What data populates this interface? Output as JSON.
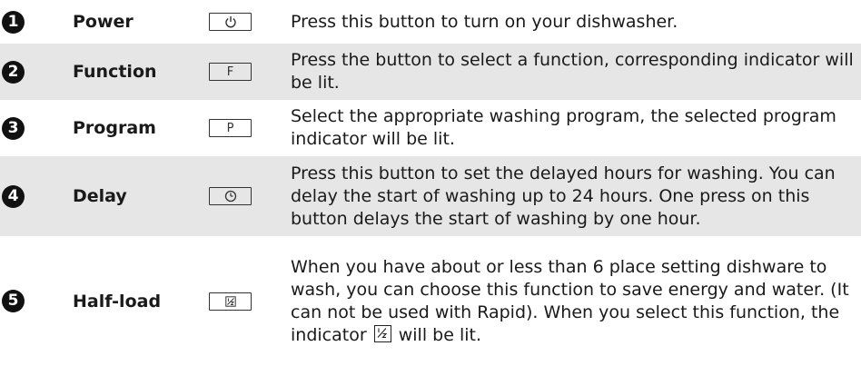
{
  "rows": [
    {
      "number": "1",
      "name": "Power",
      "button_icon": "power-icon",
      "button_label": "",
      "description": "Press this button to turn on your dishwasher."
    },
    {
      "number": "2",
      "name": "Function",
      "button_icon": "letter-f",
      "button_label": "F",
      "description": "Press the button to select a function, corresponding indicator will be lit."
    },
    {
      "number": "3",
      "name": "Program",
      "button_icon": "letter-p",
      "button_label": "P",
      "description": "Select the appropriate washing program, the selected program indicator will be lit."
    },
    {
      "number": "4",
      "name": "Delay",
      "button_icon": "delay-clock-icon",
      "button_label": "",
      "description": "Press this button to set the delayed hours for washing. You can delay the start of washing up to 24 hours. One press on this button delays the start of washing by one hour."
    },
    {
      "number": "5",
      "name": "Half-load",
      "button_icon": "half-load-icon",
      "button_label": "",
      "description_before": "When you have about or less than 6 place setting dishware to wash, you can choose this function to save energy and water. (It can not be used with Rapid). When you select this function, the indicator",
      "indicator_icon": "half-load-indicator-icon",
      "description_after": "will be lit."
    }
  ],
  "colors": {
    "shade": "#e6e6e6",
    "text": "#1a1a1a",
    "badge": "#111111"
  }
}
